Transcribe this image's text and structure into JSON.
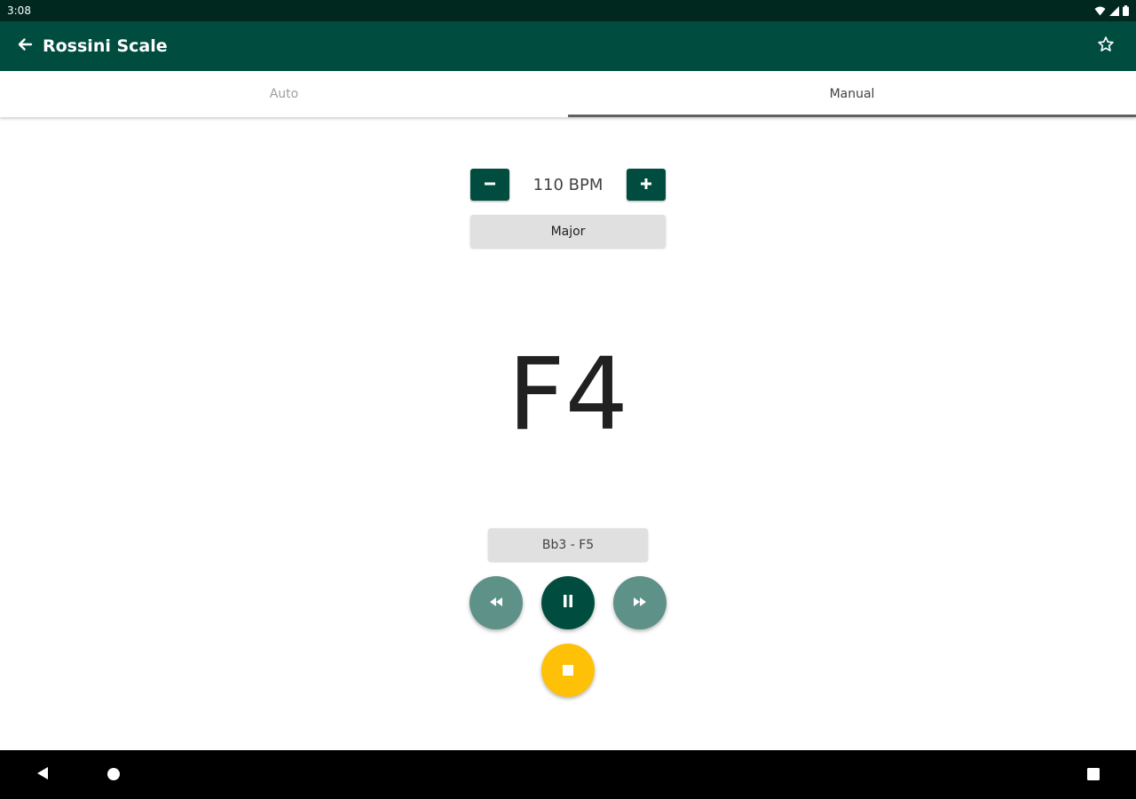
{
  "status_bar": {
    "time": "3:08",
    "icons": [
      "wifi-icon",
      "signal-icon",
      "battery-icon"
    ]
  },
  "app_bar": {
    "title": "Rossini Scale",
    "back_icon": "arrow-left-icon",
    "favorite_icon": "star-outline-icon"
  },
  "tabs": [
    {
      "label": "Auto",
      "active": false
    },
    {
      "label": "Manual",
      "active": true
    }
  ],
  "tempo": {
    "value": "110 BPM",
    "decrease_icon": "minus-icon",
    "increase_icon": "plus-icon"
  },
  "scale_type": {
    "label": "Major"
  },
  "current_note": "F4",
  "range": {
    "label": "Bb3 - F5"
  },
  "playback": {
    "rewind_icon": "rewind-icon",
    "pause_icon": "pause-icon",
    "forward_icon": "fast-forward-icon",
    "stop_icon": "stop-icon"
  },
  "colors": {
    "primary": "#004d40",
    "primary_dark": "#00281f",
    "primary_light": "#5e9187",
    "accent": "#ffc107",
    "button_gray": "#e0e0e0"
  },
  "nav_bar": {
    "icons": [
      "back-triangle-icon",
      "home-circle-icon",
      "recents-square-icon"
    ]
  }
}
